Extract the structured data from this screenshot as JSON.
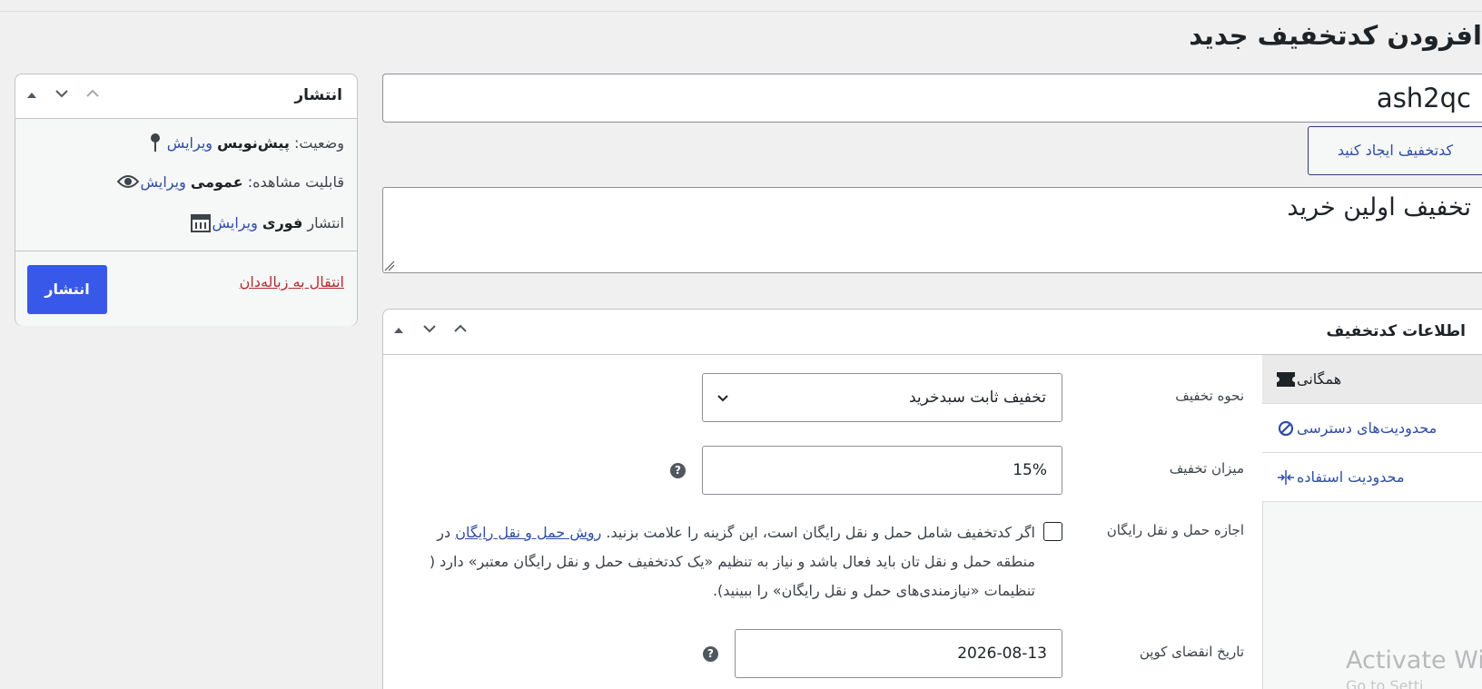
{
  "page": {
    "title": "افزودن کدتخفیف جدید"
  },
  "coupon": {
    "code_value": "ash2qc",
    "generate_label": "کدتخفیف ایجاد کنید",
    "description_value": "تخفیف اولین خرید"
  },
  "publish": {
    "title": "انتشار",
    "status_label": "وضعیت:",
    "status_value": "پیش‌نویس",
    "visibility_label": "قابلیت مشاهده:",
    "visibility_value": "عمومی",
    "schedule_label": "انتشار",
    "schedule_value": "فوری",
    "edit_label": "ویرایش",
    "trash_label": "انتقال به زباله‌دان",
    "publish_label": "انتشار"
  },
  "coupon_data": {
    "title": "اطلاعات کدتخفیف",
    "tabs": [
      {
        "label": "همگانی",
        "icon": "ticket-icon",
        "active": true
      },
      {
        "label": "محدودیت‌های دسترسی",
        "icon": "block-icon",
        "active": false
      },
      {
        "label": "محدودیت استفاده",
        "icon": "collapse-arrows-icon",
        "active": false
      }
    ],
    "discount_type_label": "نحوه تخفیف",
    "discount_type_value": "تخفیف ثابت سبدخرید",
    "amount_label": "میزان تخفیف",
    "amount_value": "15%",
    "free_shipping_label": "اجازه حمل و نقل رایگان",
    "free_shipping_text_before": "اگر کدتخفیف شامل حمل و نقل رایگان است، این گزینه را علامت بزنید.",
    "free_shipping_link": "روش حمل و نقل رایگان",
    "free_shipping_text_after": "در منطقه حمل و نقل تان باید فعال باشد و نیاز به تنظیم «یک کدتخفیف حمل و نقل رایگان معتبر» دارد ( تنظیمات «نیازمندی‌های حمل و نقل رایگان» را ببینید).",
    "expiry_label": "تاریخ انقضای کوپن",
    "expiry_value": "2026-08-13"
  },
  "watermark": {
    "line1": "Activate Wi",
    "line2": "Go to Setti"
  },
  "colors": {
    "accent": "#3858e9",
    "link": "#2f4ea3",
    "danger": "#b32d2e"
  }
}
